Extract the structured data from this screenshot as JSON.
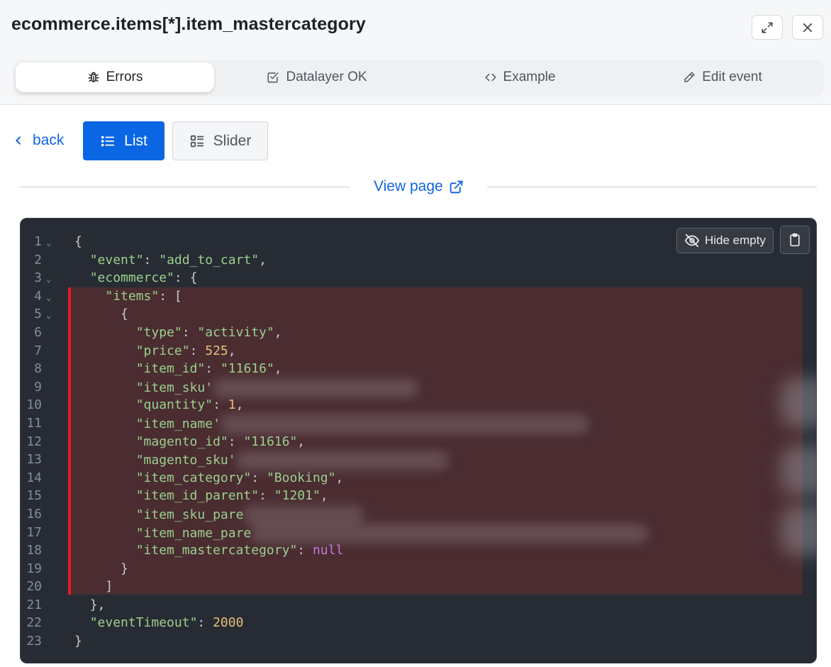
{
  "header": {
    "title": "ecommerce.items[*].item_mastercategory",
    "expand_icon": "expand-icon",
    "close_icon": "close-icon"
  },
  "tabs": [
    {
      "label": "Errors",
      "icon": "bug-icon",
      "active": true
    },
    {
      "label": "Datalayer OK",
      "icon": "check-square-icon",
      "active": false
    },
    {
      "label": "Example",
      "icon": "code-icon",
      "active": false
    },
    {
      "label": "Edit event",
      "icon": "pencil-icon",
      "active": false
    }
  ],
  "toolbar": {
    "back_label": "back",
    "list_label": "List",
    "slider_label": "Slider",
    "view_page_label": "View page"
  },
  "code_panel": {
    "hide_empty_label": "Hide empty",
    "copy_icon": "clipboard-icon",
    "highlight_color": "#4a2c31",
    "error_bar_color": "#e11a22",
    "lines": [
      {
        "n": "1",
        "fold": true,
        "text": "{"
      },
      {
        "n": "2",
        "fold": false,
        "text": "  \"event\": \"add_to_cart\","
      },
      {
        "n": "3",
        "fold": true,
        "text": "  \"ecommerce\": {"
      },
      {
        "n": "4",
        "fold": true,
        "text": "    \"items\": ["
      },
      {
        "n": "5",
        "fold": true,
        "text": "      {"
      },
      {
        "n": "6",
        "fold": false,
        "text": "        \"type\": \"activity\","
      },
      {
        "n": "7",
        "fold": false,
        "text": "        \"price\": 525,"
      },
      {
        "n": "8",
        "fold": false,
        "text": "        \"item_id\": \"11616\","
      },
      {
        "n": "9",
        "fold": false,
        "text": "        \"item_sku'"
      },
      {
        "n": "10",
        "fold": false,
        "text": "        \"quantity\": 1,"
      },
      {
        "n": "11",
        "fold": false,
        "text": "        \"item_name'"
      },
      {
        "n": "12",
        "fold": false,
        "text": "        \"magento_id\": \"11616\","
      },
      {
        "n": "13",
        "fold": false,
        "text": "        \"magento_sku'"
      },
      {
        "n": "14",
        "fold": false,
        "text": "        \"item_category\": \"Booking\","
      },
      {
        "n": "15",
        "fold": false,
        "text": "        \"item_id_parent\": \"1201\","
      },
      {
        "n": "16",
        "fold": false,
        "text": "        \"item_sku_pare"
      },
      {
        "n": "17",
        "fold": false,
        "text": "        \"item_name_pare"
      },
      {
        "n": "18",
        "fold": false,
        "text": "        \"item_mastercategory\": null"
      },
      {
        "n": "19",
        "fold": false,
        "text": "      }"
      },
      {
        "n": "20",
        "fold": false,
        "text": "    ]"
      },
      {
        "n": "21",
        "fold": false,
        "text": "  },"
      },
      {
        "n": "22",
        "fold": false,
        "text": "  \"eventTimeout\": 2000"
      },
      {
        "n": "23",
        "fold": false,
        "text": "}"
      }
    ]
  }
}
